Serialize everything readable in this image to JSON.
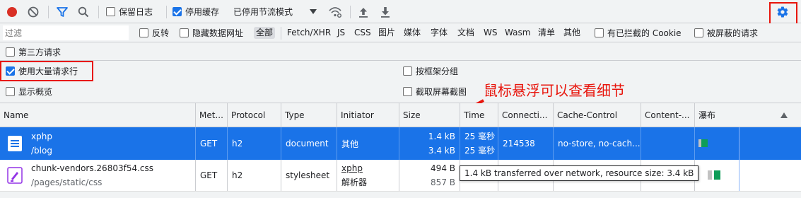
{
  "toolbar": {
    "preserve_log_label": "保留日志",
    "disable_cache_label": "停用缓存",
    "throttling_label": "已停用节流模式"
  },
  "filterbar": {
    "filter_placeholder": "过滤",
    "invert_label": "反转",
    "hide_data_urls_label": "隐藏数据网址",
    "types": [
      "全部",
      "Fetch/XHR",
      "JS",
      "CSS",
      "图片",
      "媒体",
      "字体",
      "文档",
      "WS",
      "Wasm",
      "清单",
      "其他"
    ],
    "blocked_cookies_label": "有已拦截的 Cookie",
    "blocked_requests_label": "被屏蔽的请求"
  },
  "settings": {
    "third_party_label": "第三方请求",
    "big_request_rows_label": "使用大量请求行",
    "group_by_frame_label": "按框架分组",
    "show_overview_label": "显示概览",
    "capture_screenshots_label": "截取屏幕截图"
  },
  "annotation": "鼠标悬浮可以查看细节",
  "table": {
    "headers": [
      "Name",
      "Met...",
      "Protocol",
      "Type",
      "Initiator",
      "Size",
      "Time",
      "Connecti...",
      "Cache-Control",
      "Content-...",
      "瀑布"
    ],
    "rows": [
      {
        "name": "xphp",
        "path": "/blog",
        "method": "GET",
        "protocol": "h2",
        "type": "document",
        "initiator": "其他",
        "initiator_sub": "",
        "size_transferred": "1.4 kB",
        "size_resource": "3.4 kB",
        "time": "25 毫秒",
        "time_latency": "25 毫秒",
        "connection": "214538",
        "cache_control": "no-store, no-cach...",
        "content": ""
      },
      {
        "name": "chunk-vendors.26803f54.css",
        "path": "/pages/static/css",
        "method": "GET",
        "protocol": "h2",
        "type": "stylesheet",
        "initiator": "xphp",
        "initiator_sub": "解析器",
        "size_transferred": "494 B",
        "size_resource": "857 B",
        "time": "",
        "time_latency": "",
        "connection": "",
        "cache_control": "",
        "content": ""
      }
    ]
  },
  "tooltip": "1.4 kB transferred over network, resource size: 3.4 kB",
  "colors": {
    "record": "#d93025",
    "accent": "#1a73e8",
    "annotation_red": "#e8150c"
  }
}
